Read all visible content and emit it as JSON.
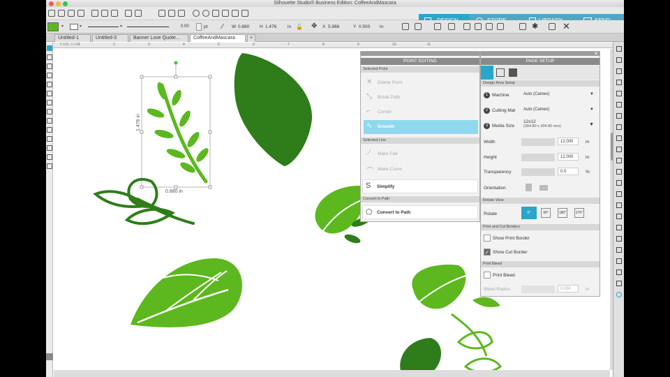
{
  "window": {
    "title": "Silhouette Studio® Business Edition: CoffeeAndMascara"
  },
  "nav": {
    "design": "DESIGN",
    "store": "STORE",
    "library": "LIBRARY",
    "send": "SEND"
  },
  "toolbar": {
    "line_width": "0.00",
    "line_unit": "pt",
    "w_label": "W",
    "w_value": "0.880",
    "h_label": "H",
    "h_value": "1.476",
    "h_unit": "in",
    "x_label": "X",
    "x_value": "5.966",
    "y_label": "Y",
    "y_value": "0.500",
    "xy_unit": "in"
  },
  "tabs": [
    {
      "label": "Untitled-1"
    },
    {
      "label": "Untitled-3"
    },
    {
      "label": "Banner Love Quote..."
    },
    {
      "label": "CoffeeAndMascara"
    }
  ],
  "ruler": {
    "coords": "6.166, 3.145",
    "marks": [
      "1",
      "2",
      "3",
      "4",
      "5",
      "6",
      "7",
      "8",
      "9",
      "10",
      "11"
    ]
  },
  "selection": {
    "height_label": "1.476 in",
    "width_label": "0.880 in"
  },
  "point_editing": {
    "title": "POINT EDITING",
    "selected_point": "Selected Point",
    "delete_point": "Delete Point",
    "break_path": "Break Path",
    "corner": "Corner",
    "smooth": "Smooth",
    "selected_line": "Selected Line",
    "make_flat": "Make Flat",
    "make_curve": "Make Curve",
    "simplify": "Simplify",
    "convert_section": "Convert to Path",
    "convert_button": "Convert to Path"
  },
  "page_setup": {
    "title": "PAGE SETUP",
    "design_area": "Design Area Setup",
    "machine_label": "Machine",
    "machine_value": "Auto (Cameo)",
    "mat_label": "Cutting Mat",
    "mat_value": "Auto (Cameo)",
    "media_label": "Media Size",
    "media_value": "12x12",
    "media_sub": "(304.80 x 304.80 mm)",
    "width_label": "Width",
    "width_value": "12.000",
    "height_label": "Height",
    "height_value": "12.000",
    "unit": "in",
    "transparency_label": "Transparency",
    "transparency_value": "0.0",
    "transparency_unit": "%",
    "orientation_label": "Orientation",
    "rotate_view": "Rotate View",
    "rotate_label": "Rotate",
    "rotate_options": [
      "0°",
      "90°",
      "180°",
      "270°"
    ],
    "print_cut": "Print and Cut Borders",
    "show_print_border": "Show Print Border",
    "show_cut_border": "Show Cut Border",
    "print_bleed": "Print Bleed",
    "print_bleed_cb": "Print Bleed",
    "bleed_radius_label": "Bleed Radius",
    "bleed_radius_value": "0.050",
    "bleed_unit": "in"
  },
  "colors": {
    "accent": "#2aa6c8",
    "dark_green": "#2e7d1a",
    "light_green": "#5cb81e"
  }
}
